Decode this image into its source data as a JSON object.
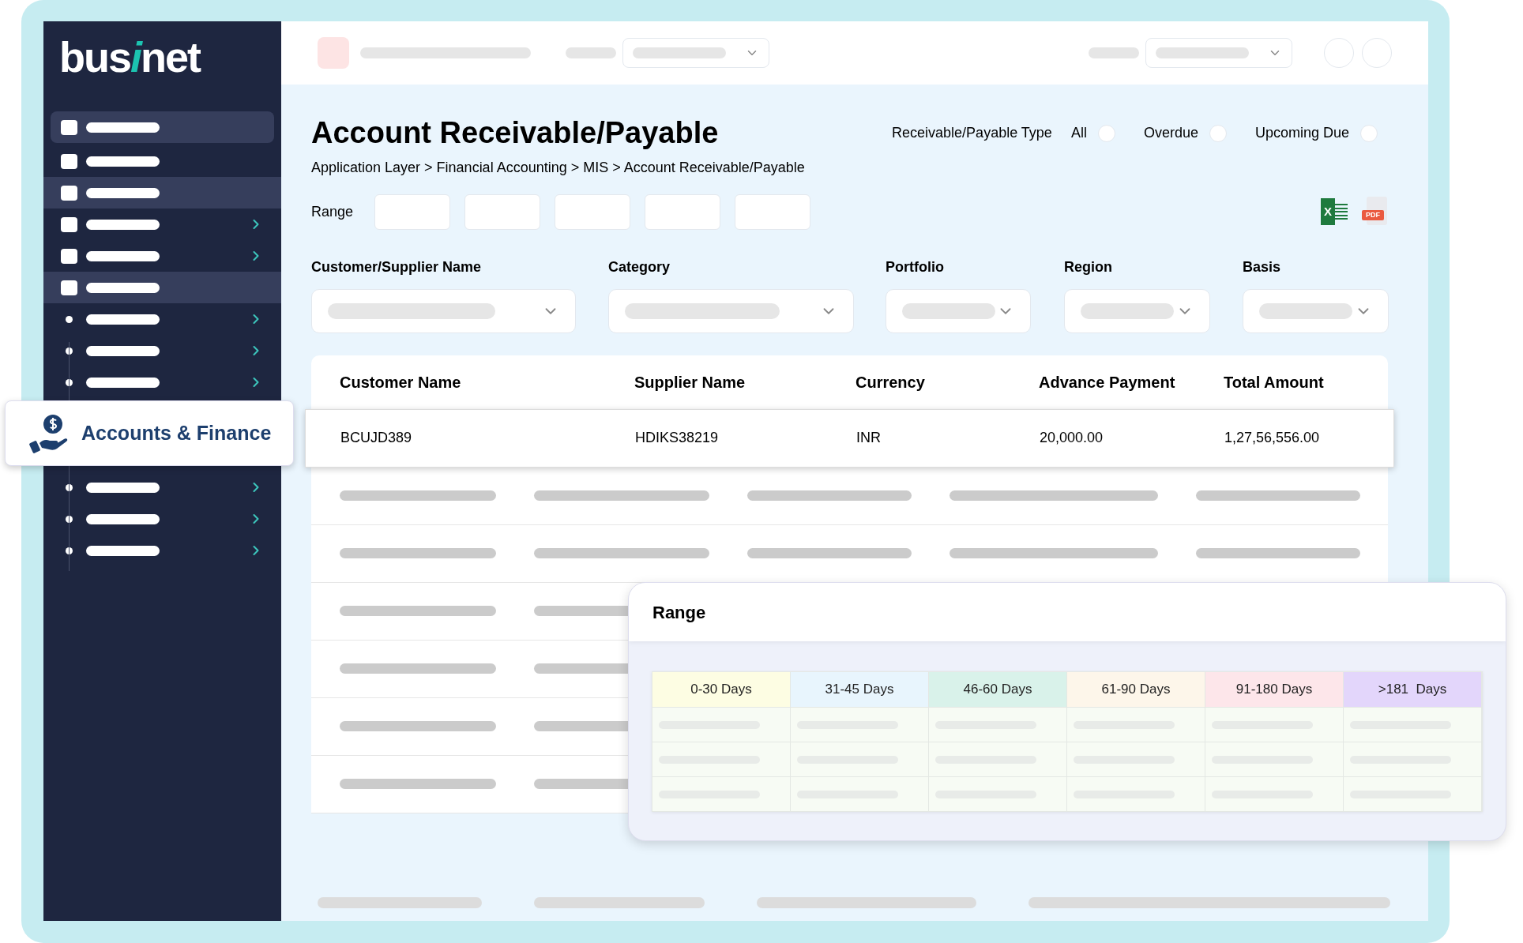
{
  "logo": {
    "parts": [
      "bus",
      "i",
      "net"
    ]
  },
  "sidebar": {
    "items": [
      {
        "kind": "square",
        "selected": true,
        "chevron": false
      },
      {
        "kind": "square",
        "selected": false,
        "chevron": false
      },
      {
        "kind": "square",
        "selected": true,
        "chevron": false
      },
      {
        "kind": "square",
        "selected": false,
        "chevron": true
      },
      {
        "kind": "square",
        "selected": false,
        "chevron": true
      },
      {
        "kind": "square",
        "selected": true,
        "chevron": false
      },
      {
        "kind": "dot",
        "selected": false,
        "chevron": true
      },
      {
        "kind": "dot",
        "selected": false,
        "chevron": true
      },
      {
        "kind": "dot",
        "selected": false,
        "chevron": true
      },
      {
        "kind": "dot",
        "selected": false,
        "chevron": true
      },
      {
        "kind": "dot",
        "selected": false,
        "chevron": true
      },
      {
        "kind": "dot",
        "selected": false,
        "chevron": true
      }
    ],
    "module_card": {
      "label": "Accounts & Finance"
    }
  },
  "page": {
    "title": "Account Receivable/Payable",
    "breadcrumb": "Application Layer > Financial Accounting > MIS > Account Receivable/Payable",
    "type_filter": {
      "label": "Receivable/Payable Type",
      "options": [
        {
          "label": "All",
          "selected": false
        },
        {
          "label": "Overdue",
          "selected": false
        },
        {
          "label": "Upcoming Due",
          "selected": false
        }
      ]
    },
    "range_label": "Range",
    "exports": {
      "excel": "X",
      "pdf": "PDF"
    },
    "filters": [
      "Customer/Supplier Name",
      "Category",
      "Portfolio",
      "Region",
      "Basis"
    ]
  },
  "table": {
    "columns": [
      "Customer Name",
      "Supplier Name",
      "Currency",
      "Advance Payment",
      "Total Amount"
    ],
    "rows": [
      [
        "BCUJD389",
        "HDIKS38219",
        "INR",
        "20,000.00",
        "1,27,56,556.00"
      ]
    ]
  },
  "range_popup": {
    "title": "Range",
    "columns": [
      {
        "label": "0-30 Days",
        "color": "#fdfde3"
      },
      {
        "label": "31-45 Days",
        "color": "#e8f5fd"
      },
      {
        "label": "46-60 Days",
        "color": "#d9f2ea"
      },
      {
        "label": "61-90 Days",
        "color": "#fdf6ea"
      },
      {
        "label": "91-180 Days",
        "color": "#fde6ea"
      },
      {
        "label": ">181  Days",
        "color": "#e3d6fb"
      }
    ]
  }
}
